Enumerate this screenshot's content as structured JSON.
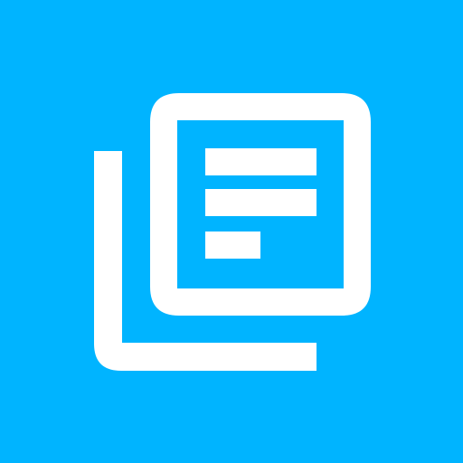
{
  "icon": {
    "name": "stacked-document-list-icon",
    "colors": {
      "background": "#00B4FF",
      "foreground": "#FFFFFF"
    }
  }
}
